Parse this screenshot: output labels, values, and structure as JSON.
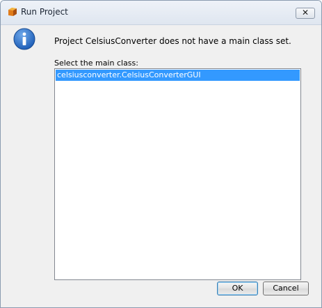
{
  "window": {
    "title": "Run Project",
    "close_label": "✕"
  },
  "dialog": {
    "message": "Project CelsiusConverter does not have a main class set.",
    "list_label": "Select the main class:",
    "items": [
      "celsiusconverter.CelsiusConverterGUI"
    ],
    "selected_index": 0
  },
  "buttons": {
    "ok": "OK",
    "cancel": "Cancel"
  },
  "colors": {
    "selection": "#3399ff",
    "info_icon": "#1f5fb8"
  }
}
